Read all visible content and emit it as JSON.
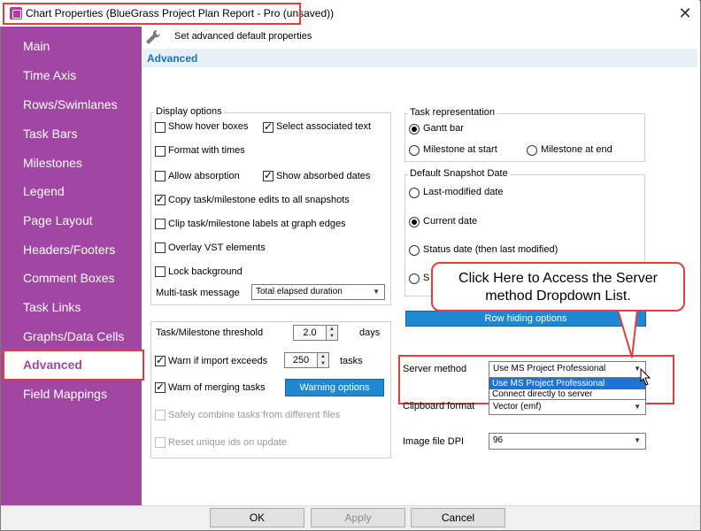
{
  "window": {
    "title": "Chart Properties (BlueGrass Project Plan Report - Pro (unsaved))",
    "close_glyph": "✕"
  },
  "sidebar": {
    "items": [
      {
        "label": "Main"
      },
      {
        "label": "Time Axis"
      },
      {
        "label": "Rows/Swimlanes"
      },
      {
        "label": "Task Bars"
      },
      {
        "label": "Milestones"
      },
      {
        "label": "Legend"
      },
      {
        "label": "Page Layout"
      },
      {
        "label": "Headers/Footers"
      },
      {
        "label": "Comment Boxes"
      },
      {
        "label": "Task Links"
      },
      {
        "label": "Graphs/Data Cells"
      },
      {
        "label": "Advanced",
        "selected": true
      },
      {
        "label": "Field Mappings"
      }
    ],
    "color": "#a246a3"
  },
  "header": {
    "icon": "wrench-icon",
    "text": "Set advanced default properties",
    "section_title": "Advanced"
  },
  "display_options": {
    "group_label": "Display options",
    "show_hover_boxes": {
      "label": "Show hover boxes",
      "checked": false
    },
    "select_associated_text": {
      "label": "Select associated text",
      "checked": true
    },
    "format_with_times": {
      "label": "Format with times",
      "checked": false
    },
    "allow_absorption": {
      "label": "Allow absorption",
      "checked": false
    },
    "show_absorbed_dates": {
      "label": "Show absorbed dates",
      "checked": true
    },
    "copy_edits": {
      "label": "Copy task/milestone edits to all snapshots",
      "checked": true
    },
    "clip_labels": {
      "label": "Clip task/milestone labels at graph edges",
      "checked": false
    },
    "overlay_vst": {
      "label": "Overlay VST elements",
      "checked": false
    },
    "lock_background": {
      "label": "Lock background",
      "checked": false
    },
    "multitask_label": "Multi-task message",
    "multitask_value": "Total elapsed duration"
  },
  "thresholds": {
    "threshold_label": "Task/Milestone threshold",
    "threshold_value": "2.0",
    "threshold_unit": "days",
    "warn_import_label": "Warn if import exceeds",
    "warn_import_value": "250",
    "warn_import_unit": "tasks",
    "warn_merge_label": "Warn of merging tasks",
    "warning_options_button": "Warning options",
    "safely_combine_label": "Safely combine tasks from different files",
    "reset_ids_label": "Reset unique ids on update"
  },
  "task_representation": {
    "group_label": "Task representation",
    "gantt": "Gantt bar",
    "milestone_start": "Milestone at start",
    "milestone_end": "Milestone at end"
  },
  "snapshot_date": {
    "group_label": "Default Snapshot Date",
    "last_modified": "Last-modified date",
    "current": "Current date",
    "status": "Status date (then last modified)",
    "partial": "S"
  },
  "row_hiding_button": "Row hiding options",
  "server": {
    "label": "Server method",
    "value": "Use MS Project Professional",
    "options": [
      "Use MS Project Professional",
      "Connect directly to server"
    ]
  },
  "clipboard": {
    "label": "Clipboard format",
    "value": "Vector (emf)"
  },
  "image_dpi": {
    "label": "Image file DPI",
    "value": "96"
  },
  "callout": {
    "line1": "Click Here to Access the Server",
    "line2": "method Dropdown List."
  },
  "footer": {
    "ok": "OK",
    "apply": "Apply",
    "cancel": "Cancel"
  }
}
